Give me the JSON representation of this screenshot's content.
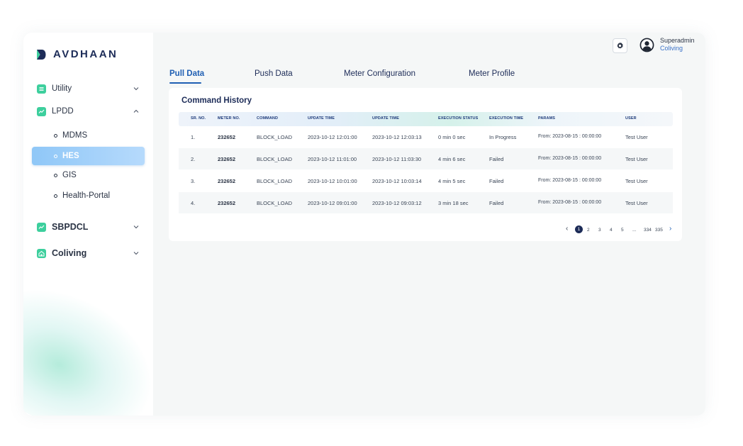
{
  "brand": {
    "name": "AVDHAAN"
  },
  "header": {
    "user_name": "Superadmin",
    "user_org": "Coliving"
  },
  "sidebar": {
    "groups": [
      {
        "label": "Utility",
        "expanded": false
      },
      {
        "label": "LPDD",
        "expanded": true
      },
      {
        "label": "SBPDCL",
        "expanded": false
      },
      {
        "label": "Coliving",
        "expanded": false
      }
    ],
    "lpdd_items": [
      {
        "label": "MDMS",
        "active": false
      },
      {
        "label": "HES",
        "active": true
      },
      {
        "label": "GIS",
        "active": false
      },
      {
        "label": "Health-Portal",
        "active": false
      }
    ]
  },
  "tabs": [
    {
      "label": "Pull Data",
      "active": true
    },
    {
      "label": "Push Data",
      "active": false
    },
    {
      "label": "Meter Configuration",
      "active": false
    },
    {
      "label": "Meter Profile",
      "active": false
    }
  ],
  "card": {
    "title": "Command History"
  },
  "table": {
    "headers": [
      "SR. NO.",
      "METER NO.",
      "COMMAND",
      "UPDATE TIME",
      "UPDATE TIME",
      "EXECUTION STATUS",
      "EXECUTION TIME",
      "PARAMS",
      "USER"
    ],
    "rows": [
      [
        "1.",
        "232652",
        "BLOCK_LOAD",
        "2023-10-12 12:01:00",
        "2023-10-12 12:03:13",
        "0 min 0 sec",
        "In Progress",
        "From: 2023-08-15 : 00:00:00",
        "Test User"
      ],
      [
        "2.",
        "232652",
        "BLOCK_LOAD",
        "2023-10-12 11:01:00",
        "2023-10-12 11:03:30",
        "4 min 6 sec",
        "Failed",
        "From: 2023-08-15 : 00:00:00",
        "Test User"
      ],
      [
        "3.",
        "232652",
        "BLOCK_LOAD",
        "2023-10-12 10:01:00",
        "2023-10-12 10:03:14",
        "4 min 5 sec",
        "Failed",
        "From: 2023-08-15 : 00:00:00",
        "Test User"
      ],
      [
        "4.",
        "232652",
        "BLOCK_LOAD",
        "2023-10-12 09:01:00",
        "2023-10-12 09:03:12",
        "3 min 18 sec",
        "Failed",
        "From: 2023-08-15 : 00:00:00",
        "Test User"
      ]
    ]
  },
  "pagination": {
    "prev": "‹",
    "pages": [
      "1",
      "2",
      "3",
      "4",
      "5",
      "...",
      "334",
      "335"
    ],
    "current": "1",
    "next": "›"
  },
  "colors": {
    "brand_navy": "#1d2c58",
    "accent_blue": "#1f5fb3",
    "icon_green": "#3dcf9d",
    "active_item": "#9ccdf8"
  }
}
